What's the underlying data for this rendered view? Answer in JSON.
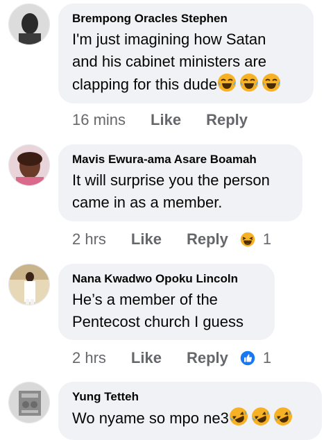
{
  "comments": [
    {
      "author": "Brempong Oracles Stephen",
      "text": "I'm just imagining how Satan and his cabinet ministers are clapping for this dude",
      "text_lines": [
        "I'm just imagining how Satan",
        "and his cabinet ministers are",
        "clapping for this dude"
      ],
      "emojis": [
        "laughing-tears-emoji",
        "laughing-tears-emoji",
        "laughing-tears-emoji"
      ],
      "time": "16 mins",
      "like_label": "Like",
      "reply_label": "Reply",
      "reaction": null,
      "reaction_count": ""
    },
    {
      "author": "Mavis Ewura-ama Asare Boamah",
      "text_lines": [
        "It will surprise you the person",
        "came in as a member."
      ],
      "time": "2 hrs",
      "like_label": "Like",
      "reply_label": "Reply",
      "reaction": "haha-reaction-icon",
      "reaction_count": "1"
    },
    {
      "author": "Nana Kwadwo Opoku Lincoln",
      "text_lines": [
        "He’s a member of the",
        "Pentecost church I guess"
      ],
      "time": "2 hrs",
      "like_label": "Like",
      "reply_label": "Reply",
      "reaction": "like-reaction-icon",
      "reaction_count": "1"
    },
    {
      "author": "Yung Tetteh",
      "text_lines": [
        "Wo nyame so mpo ne3"
      ],
      "emojis": [
        "rolling-laughing-emoji",
        "rolling-laughing-emoji",
        "rolling-laughing-emoji"
      ]
    }
  ],
  "colors": {
    "bubble": "#f0f2f5",
    "meta_text": "#65676b",
    "like_blue": "#1877f2",
    "emoji_yellow": "#f7b125"
  }
}
